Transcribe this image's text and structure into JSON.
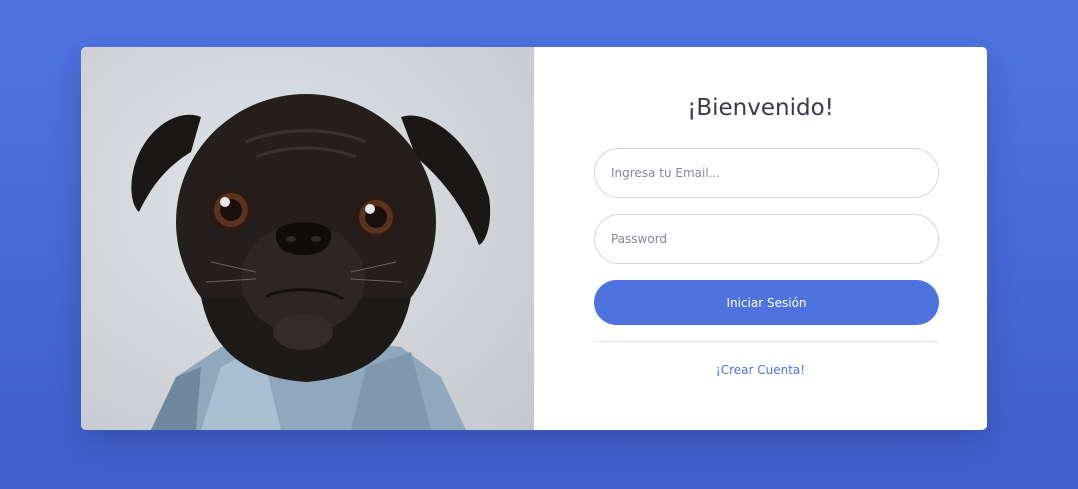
{
  "image": {
    "subject": "pug-photo"
  },
  "form": {
    "title": "¡Bienvenido!",
    "email_placeholder": "Ingresa tu Email...",
    "password_placeholder": "Password",
    "submit_label": "Iniciar Sesión",
    "create_account_label": "¡Crear Cuenta!"
  },
  "colors": {
    "accent": "#4e73df",
    "background": "#4e73df",
    "card": "#ffffff",
    "title_text": "#3a3b45",
    "input_border": "#d1d3e2"
  }
}
